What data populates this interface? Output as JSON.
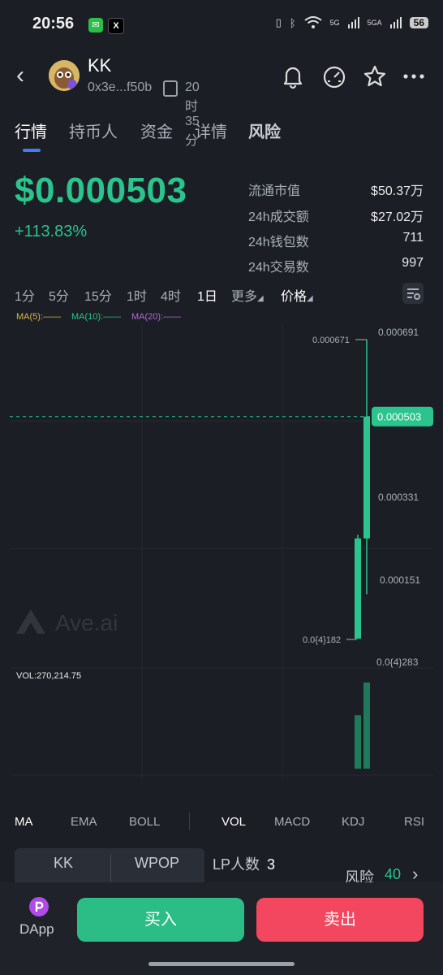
{
  "status_bar": {
    "time": "20:56",
    "wechat_icon": "wechat-icon",
    "x_icon": "x-app-icon",
    "net1": "5G",
    "net2": "5GA",
    "battery": "56"
  },
  "header": {
    "token_name": "KK",
    "address": "0x3e...f50b",
    "age": "20时35分"
  },
  "tabs": [
    {
      "label": "行情",
      "active": true
    },
    {
      "label": "持币人",
      "active": false
    },
    {
      "label": "资金",
      "active": false
    },
    {
      "label": "详情",
      "active": false
    },
    {
      "label": "风险",
      "active": false
    }
  ],
  "price": {
    "value": "$0.000503",
    "change": "+113.83%"
  },
  "stats": [
    {
      "label": "流通市值",
      "value": "$50.37万"
    },
    {
      "label": "24h成交额",
      "value": "$27.02万"
    },
    {
      "label": "24h钱包数",
      "value": "711"
    },
    {
      "label": "24h交易数",
      "value": "997"
    }
  ],
  "intervals": [
    "1分",
    "5分",
    "15分",
    "1时",
    "4时",
    "1日"
  ],
  "active_interval": "1日",
  "more_label": "更多",
  "price_label": "价格",
  "ma_legend": {
    "ma5": "MA(5):——",
    "ma10": "MA(10):——",
    "ma20": "MA(20):——"
  },
  "colors": {
    "up": "#2ac48c",
    "ma5": "#d8b84a",
    "ma10": "#2ac48c",
    "ma20": "#b06ad8",
    "accent": "#3f7df2",
    "sell": "#f2475f"
  },
  "chart_data": {
    "type": "candlestick",
    "y_ticks": [
      "0.000691",
      "0.000331",
      "0.000151",
      "0.0{4}283"
    ],
    "current_price_label": "0.000503",
    "high_label": "0.000671",
    "low_label": "0.0{4}182",
    "watermark": "Ave.ai",
    "volume_label": "VOL:270,214.75",
    "candles": [
      {
        "open": 0.000237,
        "high": 0.000245,
        "low": 1.82e-05,
        "close": 1.82e-05
      },
      {
        "open": 0.000237,
        "high": 0.000671,
        "low": 0.000115,
        "close": 0.000503
      }
    ],
    "volume_relative": [
      0.62,
      1.0
    ]
  },
  "indicators": [
    "MA",
    "EMA",
    "BOLL",
    "VOL",
    "MACD",
    "KDJ",
    "RSI"
  ],
  "active_indicators": [
    "MA",
    "VOL"
  ],
  "pool": {
    "token_a": "KK",
    "token_b": "WPOP"
  },
  "lp": {
    "label": "LP人数",
    "value": "3"
  },
  "risk": {
    "label": "风险",
    "value": "40"
  },
  "bottom": {
    "dapp_label": "DApp",
    "buy_label": "买入",
    "sell_label": "卖出"
  }
}
